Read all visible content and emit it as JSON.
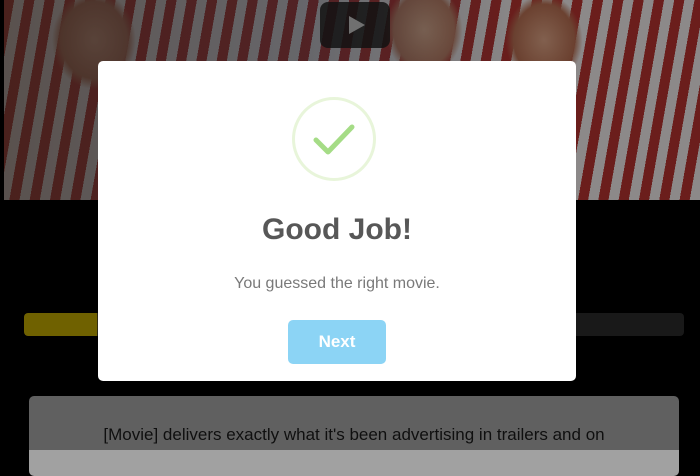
{
  "background": {
    "play_icon": "play-icon",
    "progress_fraction": 0.11,
    "review_text": "[Movie] delivers exactly what it's been advertising in trailers and on"
  },
  "modal": {
    "icon": "checkmark-icon",
    "title": "Good Job!",
    "message": "You guessed the right movie.",
    "button_label": "Next"
  },
  "colors": {
    "checkmark": "#a5dc86",
    "button": "#8cd4f5",
    "progress": "#b9a200"
  }
}
